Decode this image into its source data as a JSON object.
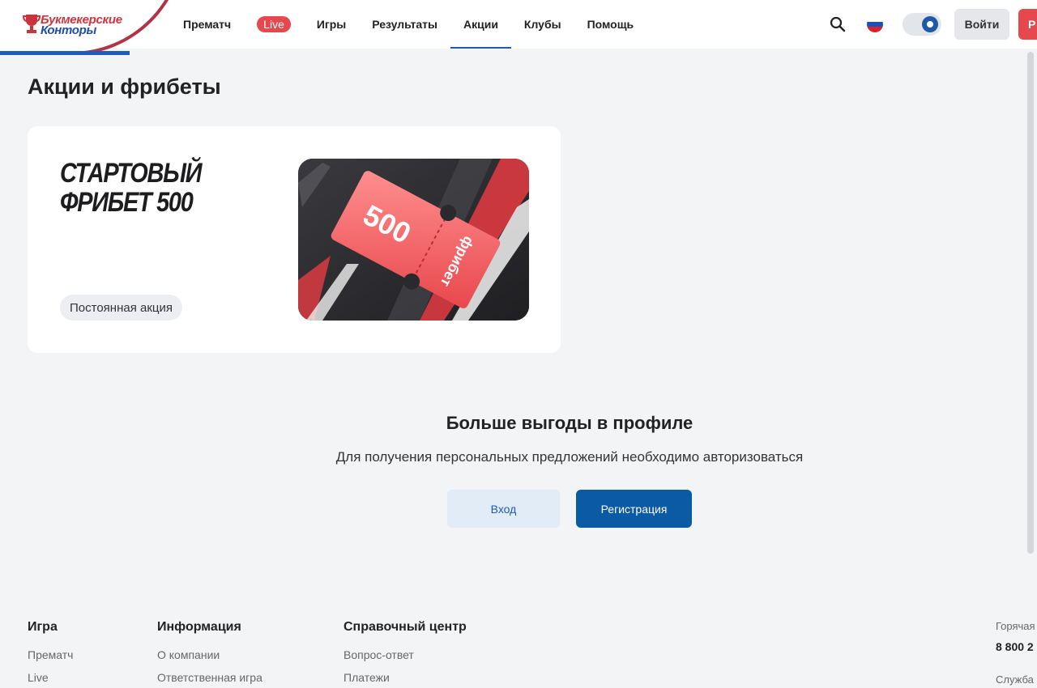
{
  "brand": {
    "logo_line1": "Букмекерские",
    "logo_line2": "Конторы",
    "primary_color": "#1e5aa8",
    "accent_color": "#e5484d"
  },
  "header": {
    "nav": [
      {
        "label": "Прематч",
        "active": false
      },
      {
        "label": "Live",
        "active": false,
        "badge": true
      },
      {
        "label": "Игры",
        "active": false
      },
      {
        "label": "Результаты",
        "active": false
      },
      {
        "label": "Акции",
        "active": true
      },
      {
        "label": "Клубы",
        "active": false
      },
      {
        "label": "Помощь",
        "active": false
      }
    ],
    "icons": {
      "search": "search-icon",
      "flag": "russia-flag-icon",
      "theme_toggle": "theme-toggle"
    },
    "login_label": "Войти",
    "register_label": "Р"
  },
  "page": {
    "title": "Акции и фрибеты"
  },
  "promo": {
    "title": "Стартовый фрибет 500",
    "badge": "Постоянная акция",
    "image_number": "500",
    "image_word": "фрибет"
  },
  "cta": {
    "title": "Больше выгоды в профиле",
    "subtitle": "Для получения персональных предложений необходимо авторизоваться",
    "login_label": "Вход",
    "register_label": "Регистрация"
  },
  "footer": {
    "columns": [
      {
        "heading": "Игра",
        "links": [
          "Прематч",
          "Live"
        ]
      },
      {
        "heading": "Информация",
        "links": [
          "О компании",
          "Ответственная игра"
        ]
      },
      {
        "heading": "Справочный центр",
        "links": [
          "Вопрос-ответ",
          "Платежи"
        ]
      }
    ],
    "hotline_label": "Горячая",
    "hotline_number": "8 800 2",
    "service_label": "Служба"
  }
}
